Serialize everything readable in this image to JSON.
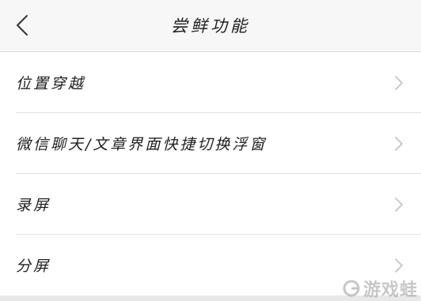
{
  "header": {
    "back_icon": "chevron-left-icon",
    "title": "尝鲜功能"
  },
  "menu": {
    "items": [
      {
        "label": "位置穿越",
        "icon": "chevron-right-icon"
      },
      {
        "label": "微信聊天/文章界面快捷切换浮窗",
        "icon": "chevron-right-icon"
      },
      {
        "label": "录屏",
        "icon": "chevron-right-icon"
      },
      {
        "label": "分屏",
        "icon": "chevron-right-icon"
      }
    ]
  },
  "watermark": {
    "text": "游戏蛙"
  },
  "colors": {
    "nav_background": "#f7f7f7",
    "list_background": "#ffffff",
    "page_background": "#f2f2f2",
    "divider": "#e3e3e3",
    "chevron": "#c2c2c2",
    "text": "#1e1e1e"
  }
}
